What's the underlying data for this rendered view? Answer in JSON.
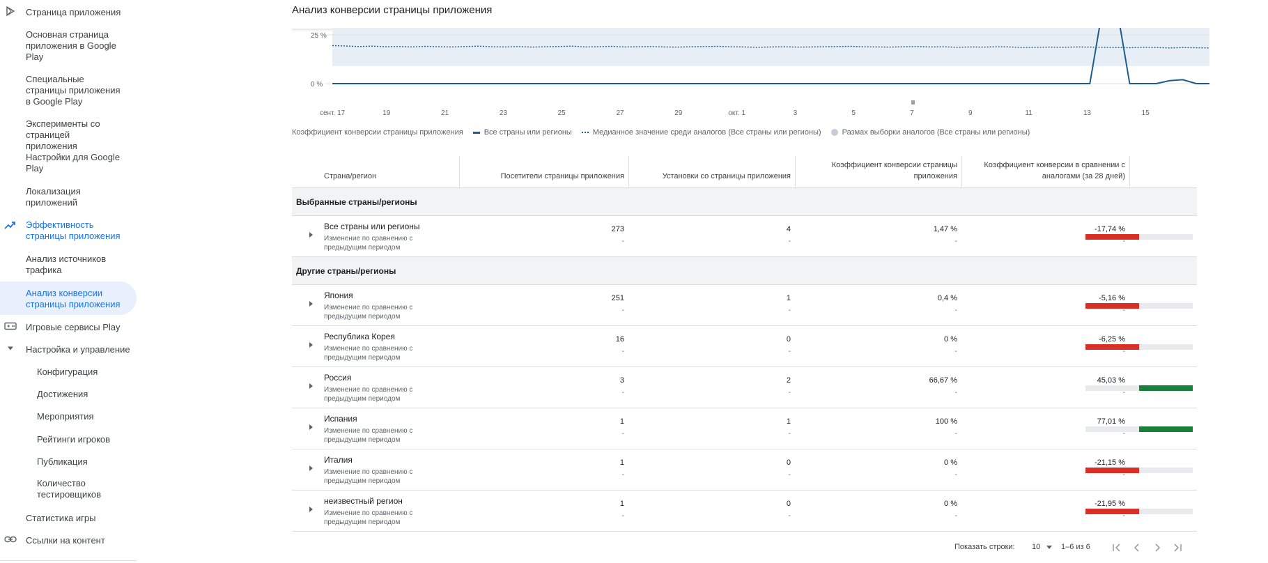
{
  "sidebar": {
    "items": [
      {
        "label": "Страница приложения",
        "icon": "play-store-icon"
      },
      {
        "label": "Основная страница приложения в Google Play"
      },
      {
        "label": "Специальные страницы приложения в Google Play"
      },
      {
        "label": "Эксперименты со страницей приложения"
      },
      {
        "label": "Настройки для Google Play"
      },
      {
        "label": "Локализация приложений"
      },
      {
        "label": "Эффективность страницы приложения",
        "icon": "trending-up-icon"
      },
      {
        "label": "Анализ источников трафика"
      },
      {
        "label": "Анализ конверсии страницы приложения"
      },
      {
        "label": "Игровые сервисы Play",
        "icon": "gamepad-icon"
      },
      {
        "label": "Настройка и управление",
        "icon": "caret-down-icon"
      },
      {
        "label": "Конфигурация"
      },
      {
        "label": "Достижения"
      },
      {
        "label": "Мероприятия"
      },
      {
        "label": "Рейтинги игроков"
      },
      {
        "label": "Публикация"
      },
      {
        "label": "Количество тестировщиков"
      },
      {
        "label": "Статистика игры"
      },
      {
        "label": "Ссылки на контент",
        "icon": "link-icon"
      }
    ]
  },
  "page_title": "Анализ конверсии страницы приложения",
  "chart_data": {
    "type": "line",
    "y_ticks": [
      "25 %",
      "0 %"
    ],
    "x_ticks": [
      "сент. 17",
      "19",
      "21",
      "23",
      "25",
      "27",
      "29",
      "окт. 1",
      "3",
      "5",
      "7",
      "9",
      "11",
      "13",
      "15"
    ],
    "series": [
      {
        "name": "Все страны или регионы",
        "style": "solid",
        "color": "#1f5c8c",
        "values": [
          0,
          0,
          0,
          0,
          0,
          0,
          0,
          0,
          0,
          0,
          0,
          0,
          0,
          0,
          0,
          0,
          0,
          0,
          0,
          0,
          0,
          0,
          0,
          0,
          0,
          0,
          0,
          0,
          0,
          0,
          0,
          0,
          0,
          0,
          0,
          0,
          0,
          0,
          0,
          0,
          0,
          0,
          0,
          0,
          0,
          0,
          0,
          0,
          0,
          0,
          0,
          0,
          0,
          0,
          0,
          0,
          0,
          0,
          40,
          40,
          0,
          0,
          0,
          1.5,
          2,
          0,
          0
        ]
      },
      {
        "name": "Медианное значение среди аналогов (Все страны или регионы)",
        "style": "dotted",
        "color": "#1f5c8c",
        "values": [
          19.5,
          19.3,
          19.0,
          19.2,
          18.9,
          19.0,
          18.8,
          19.1,
          18.9,
          18.8,
          19.0,
          19.2,
          18.9,
          18.8,
          19.0,
          18.7,
          18.9,
          19.0,
          19.2,
          18.8,
          18.9,
          19.1,
          18.8,
          18.9,
          19.0,
          18.8,
          18.7,
          18.9,
          19.0,
          19.1,
          18.9,
          18.8,
          18.6,
          18.8,
          18.9,
          18.7,
          18.8,
          18.9,
          19.0,
          19.1,
          18.9,
          18.8,
          18.7,
          18.9,
          19.0,
          18.8,
          18.9,
          18.6,
          18.8,
          18.7,
          18.9,
          18.8,
          18.5,
          18.6,
          18.7,
          18.6,
          18.8,
          18.7,
          18.6,
          18.5,
          18.4,
          18.6,
          18.5,
          18.3,
          18.5,
          18.4,
          18.3
        ]
      },
      {
        "name": "Размах выборки аналогов (Все страны или регионы)",
        "style": "band",
        "color": "#e7eef5",
        "low": 9,
        "high": 30
      }
    ],
    "ylim": [
      0,
      30
    ]
  },
  "legend": {
    "title": "Коэффициент конверсии страницы приложения",
    "items": [
      "Все страны или регионы",
      "Медианное значение среди аналогов (Все страны или регионы)",
      "Размах выборки аналогов (Все страны или регионы)"
    ]
  },
  "table": {
    "headers": {
      "country": "Страна/регион",
      "visitors": "Посетители страницы приложения",
      "installs": "Установки со страницы приложения",
      "conversion": "Коэффициент конверсии страницы приложения",
      "vs_peers": "Коэффициент конверсии в сравнении с аналогами (за 28 дней)"
    },
    "group_selected": "Выбранные страны/регионы",
    "group_other": "Другие страны/регионы",
    "change_label": "Изменение по сравнению с предыдущим периодом",
    "dash": "-",
    "selected_rows": [
      {
        "country": "Все страны или регионы",
        "visitors": "273",
        "installs": "4",
        "conversion": "1,47 %",
        "vs_peers": "-17,74 %",
        "bar": -0.5
      }
    ],
    "other_rows": [
      {
        "country": "Япония",
        "visitors": "251",
        "installs": "1",
        "conversion": "0,4 %",
        "vs_peers": "-5,16 %",
        "bar": -0.5
      },
      {
        "country": "Республика Корея",
        "visitors": "16",
        "installs": "0",
        "conversion": "0 %",
        "vs_peers": "-6,25 %",
        "bar": -0.5
      },
      {
        "country": "Россия",
        "visitors": "3",
        "installs": "2",
        "conversion": "66,67 %",
        "vs_peers": "45,03 %",
        "bar": 0.5
      },
      {
        "country": "Испания",
        "visitors": "1",
        "installs": "1",
        "conversion": "100 %",
        "vs_peers": "77,01 %",
        "bar": 0.5
      },
      {
        "country": "Италия",
        "visitors": "1",
        "installs": "0",
        "conversion": "0 %",
        "vs_peers": "-21,15 %",
        "bar": -0.5
      },
      {
        "country": "неизвестный регион",
        "visitors": "1",
        "installs": "0",
        "conversion": "0 %",
        "vs_peers": "-21,95 %",
        "bar": -0.5
      }
    ],
    "colors": {
      "negative": "#d93025",
      "positive": "#188038",
      "track": "#e8eaed"
    }
  },
  "pager": {
    "rows_label": "Показать строки:",
    "rows_value": "10",
    "range": "1–6 из 6"
  }
}
